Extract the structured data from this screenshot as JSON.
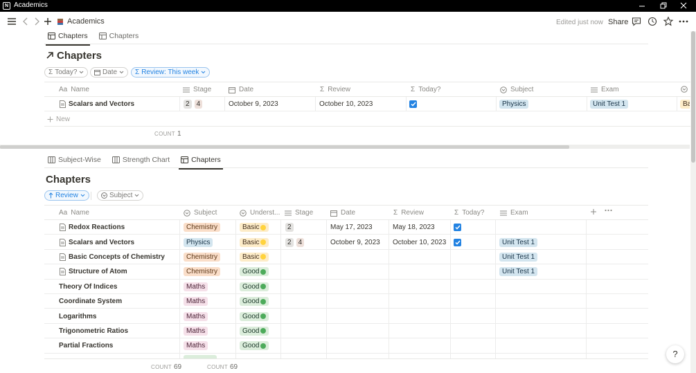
{
  "window": {
    "title": "Academics"
  },
  "topbar": {
    "breadcrumb": "Academics",
    "edited": "Edited just now",
    "share": "Share"
  },
  "top_view": {
    "tabs": [
      "Chapters",
      "Chapters"
    ],
    "title": "Chapters",
    "filters": [
      "Today?",
      "Date",
      "Review: This week"
    ],
    "headers": [
      "Name",
      "Stage",
      "Date",
      "Review",
      "Today?",
      "Subject",
      "Exam"
    ],
    "rows": [
      {
        "name": "Scalars and Vectors",
        "stage": [
          "2",
          "4"
        ],
        "date": "October 9, 2023",
        "review": "October 10, 2023",
        "today": true,
        "subject": "Physics",
        "exam": "Unit Test 1",
        "extra": "Ba"
      }
    ],
    "new_label": "New",
    "count_label": "COUNT",
    "count_value": "1"
  },
  "bottom_view": {
    "tabs": [
      "Subject-Wise",
      "Strength Chart",
      "Chapters"
    ],
    "title": "Chapters",
    "filters": [
      "Review",
      "Subject"
    ],
    "headers": [
      "Name",
      "Subject",
      "Underst...",
      "Stage",
      "Date",
      "Review",
      "Today?",
      "Exam"
    ],
    "rows": [
      {
        "name": "Redox Reactions",
        "doc": true,
        "subject": "Chemistry",
        "level": "Basic",
        "stage": [
          "2"
        ],
        "date": "May 17, 2023",
        "review": "May 18, 2023",
        "today": true,
        "exam": ""
      },
      {
        "name": "Scalars and Vectors",
        "doc": true,
        "subject": "Physics",
        "level": "Basic",
        "stage": [
          "2",
          "4"
        ],
        "date": "October 9, 2023",
        "review": "October 10, 2023",
        "today": true,
        "exam": "Unit Test 1"
      },
      {
        "name": "Basic Concepts of Chemistry",
        "doc": true,
        "subject": "Chemistry",
        "level": "Basic",
        "stage": [],
        "date": "",
        "review": "",
        "today": false,
        "exam": "Unit Test 1"
      },
      {
        "name": "Structure of Atom",
        "doc": true,
        "subject": "Chemistry",
        "level": "Good",
        "stage": [],
        "date": "",
        "review": "",
        "today": false,
        "exam": "Unit Test 1"
      },
      {
        "name": "Theory Of Indices",
        "doc": false,
        "subject": "Maths",
        "level": "Good",
        "stage": [],
        "date": "",
        "review": "",
        "today": false,
        "exam": ""
      },
      {
        "name": "Coordinate System",
        "doc": false,
        "subject": "Maths",
        "level": "Good",
        "stage": [],
        "date": "",
        "review": "",
        "today": false,
        "exam": ""
      },
      {
        "name": "Logarithms",
        "doc": false,
        "subject": "Maths",
        "level": "Good",
        "stage": [],
        "date": "",
        "review": "",
        "today": false,
        "exam": ""
      },
      {
        "name": "Trigonometric Ratios",
        "doc": false,
        "subject": "Maths",
        "level": "Good",
        "stage": [],
        "date": "",
        "review": "",
        "today": false,
        "exam": ""
      },
      {
        "name": "Partial Fractions",
        "doc": false,
        "subject": "Maths",
        "level": "Good",
        "stage": [],
        "date": "",
        "review": "",
        "today": false,
        "exam": ""
      }
    ],
    "count_label": "COUNT",
    "count_value_1": "69",
    "count_value_2": "69"
  },
  "colors": {
    "accent": "#2383e2",
    "basic_dot": "#ffd33d",
    "good_dot": "#4dab5b"
  },
  "help": "?"
}
